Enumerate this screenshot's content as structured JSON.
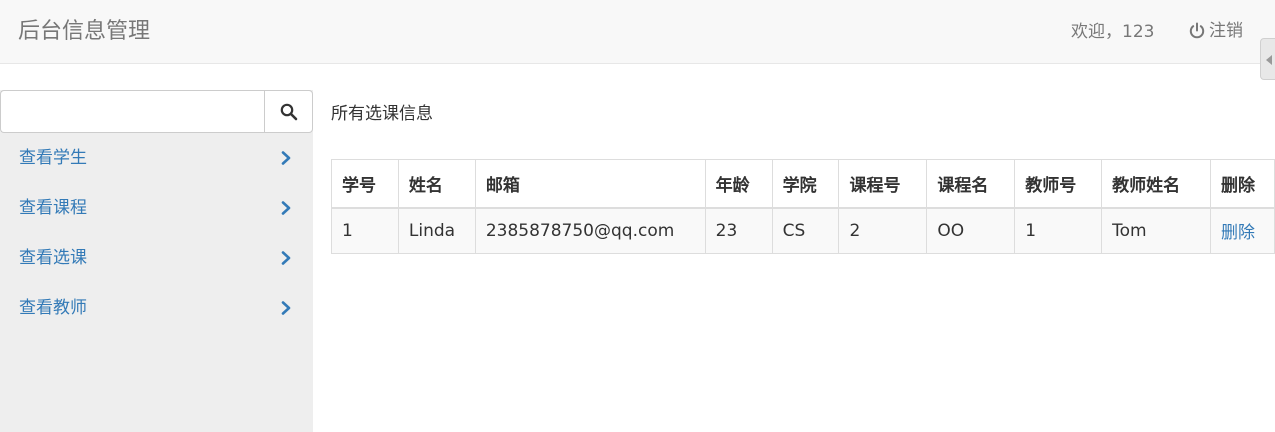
{
  "header": {
    "brand": "后台信息管理",
    "welcome": "欢迎，123",
    "logout_label": "注销"
  },
  "sidebar": {
    "search": {
      "value": "",
      "placeholder": ""
    },
    "items": [
      {
        "label": "查看学生"
      },
      {
        "label": "查看课程"
      },
      {
        "label": "查看选课"
      },
      {
        "label": "查看教师"
      }
    ]
  },
  "main": {
    "title": "所有选课信息",
    "table": {
      "headers": [
        "学号",
        "姓名",
        "邮箱",
        "年龄",
        "学院",
        "课程号",
        "课程名",
        "教师号",
        "教师姓名",
        "删除"
      ],
      "rows": [
        [
          "1",
          "Linda",
          "2385878750@qq.com",
          "23",
          "CS",
          "2",
          "OO",
          "1",
          "Tom",
          "删除"
        ]
      ]
    }
  },
  "colors": {
    "link": "#337ab7",
    "navbar_bg": "#f8f8f8",
    "sidebar_bg": "#eeeeee"
  },
  "icons": {
    "logout": "power-icon",
    "search": "search-icon",
    "nav": "chevron-right-icon",
    "collapse": "caret-left-icon"
  }
}
